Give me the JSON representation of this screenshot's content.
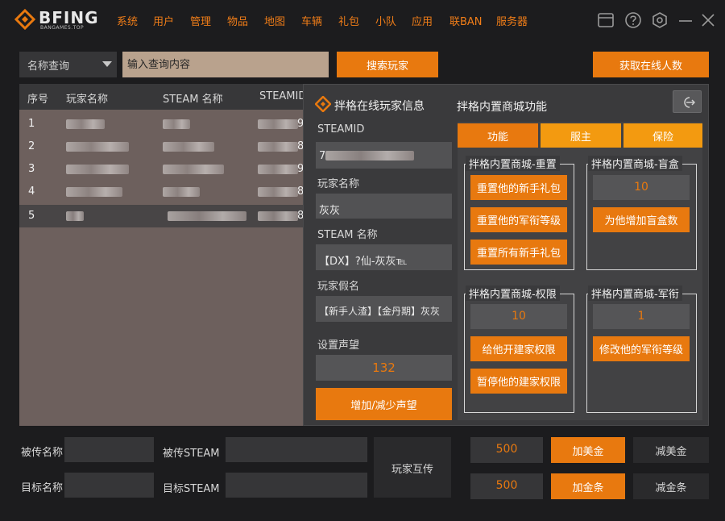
{
  "app": {
    "logo_text": "BFING",
    "logo_sub": "BANGAMES.TOP",
    "nav": [
      "系统",
      "用户",
      "管理",
      "物品",
      "地图",
      "车辆",
      "礼包",
      "小队",
      "应用",
      "联BAN",
      "服务器"
    ]
  },
  "search": {
    "select_value": "名称查询",
    "placeholder": "输入查询内容",
    "search_button": "搜索玩家",
    "online_button": "获取在线人数"
  },
  "table": {
    "headers": [
      "序号",
      "玩家名称",
      "STEAM 名称",
      "STEAMID"
    ],
    "rows": [
      "1",
      "2",
      "3",
      "4",
      "5"
    ],
    "steamid_tail": [
      "9",
      "8",
      "9",
      "8",
      "8"
    ]
  },
  "panel": {
    "title": "拌格在线玩家信息",
    "steamid_label": "STEAMID",
    "steamid_value": "7",
    "name_label": "玩家名称",
    "name_value": "灰灰",
    "steam_name_label": "STEAM 名称",
    "steam_name_value": "【DX】?仙-灰灰℡",
    "alias_label": "玩家假名",
    "alias_value": "【新手人渣】【金丹期】灰灰",
    "rep_label": "设置声望",
    "rep_value": "132",
    "rep_button": "增加/减少声望",
    "shop_title": "拌格内置商城功能",
    "tabs": [
      "功能",
      "服主",
      "保险"
    ],
    "groups": {
      "reset": {
        "title": "拌格内置商城-重置",
        "buttons": [
          "重置他的新手礼包",
          "重置他的军衔等级",
          "重置所有新手礼包"
        ]
      },
      "blindbox": {
        "title": "拌格内置商城-盲盒",
        "value": "10",
        "button": "为他增加盲盒数"
      },
      "permission": {
        "title": "拌格内置商城-权限",
        "value": "10",
        "buttons": [
          "给他开建家权限",
          "暂停他的建家权限"
        ]
      },
      "rank": {
        "title": "拌格内置商城-军衔",
        "value": "1",
        "button": "修改他的军衔等级"
      }
    }
  },
  "bottom": {
    "src_name_label": "被传名称",
    "src_steam_label": "被传STEAM",
    "dst_name_label": "目标名称",
    "dst_steam_label": "目标STEAM",
    "transfer_button": "玩家互传",
    "usd_value": "500",
    "gold_value": "500",
    "add_usd": "加美金",
    "sub_usd": "减美金",
    "add_gold": "加金条",
    "sub_gold": "减金条"
  },
  "colors": {
    "accent": "#e8790f",
    "background": "#1c1c1e",
    "panel": "#3a3a3c",
    "table_bg": "#6d605d"
  }
}
